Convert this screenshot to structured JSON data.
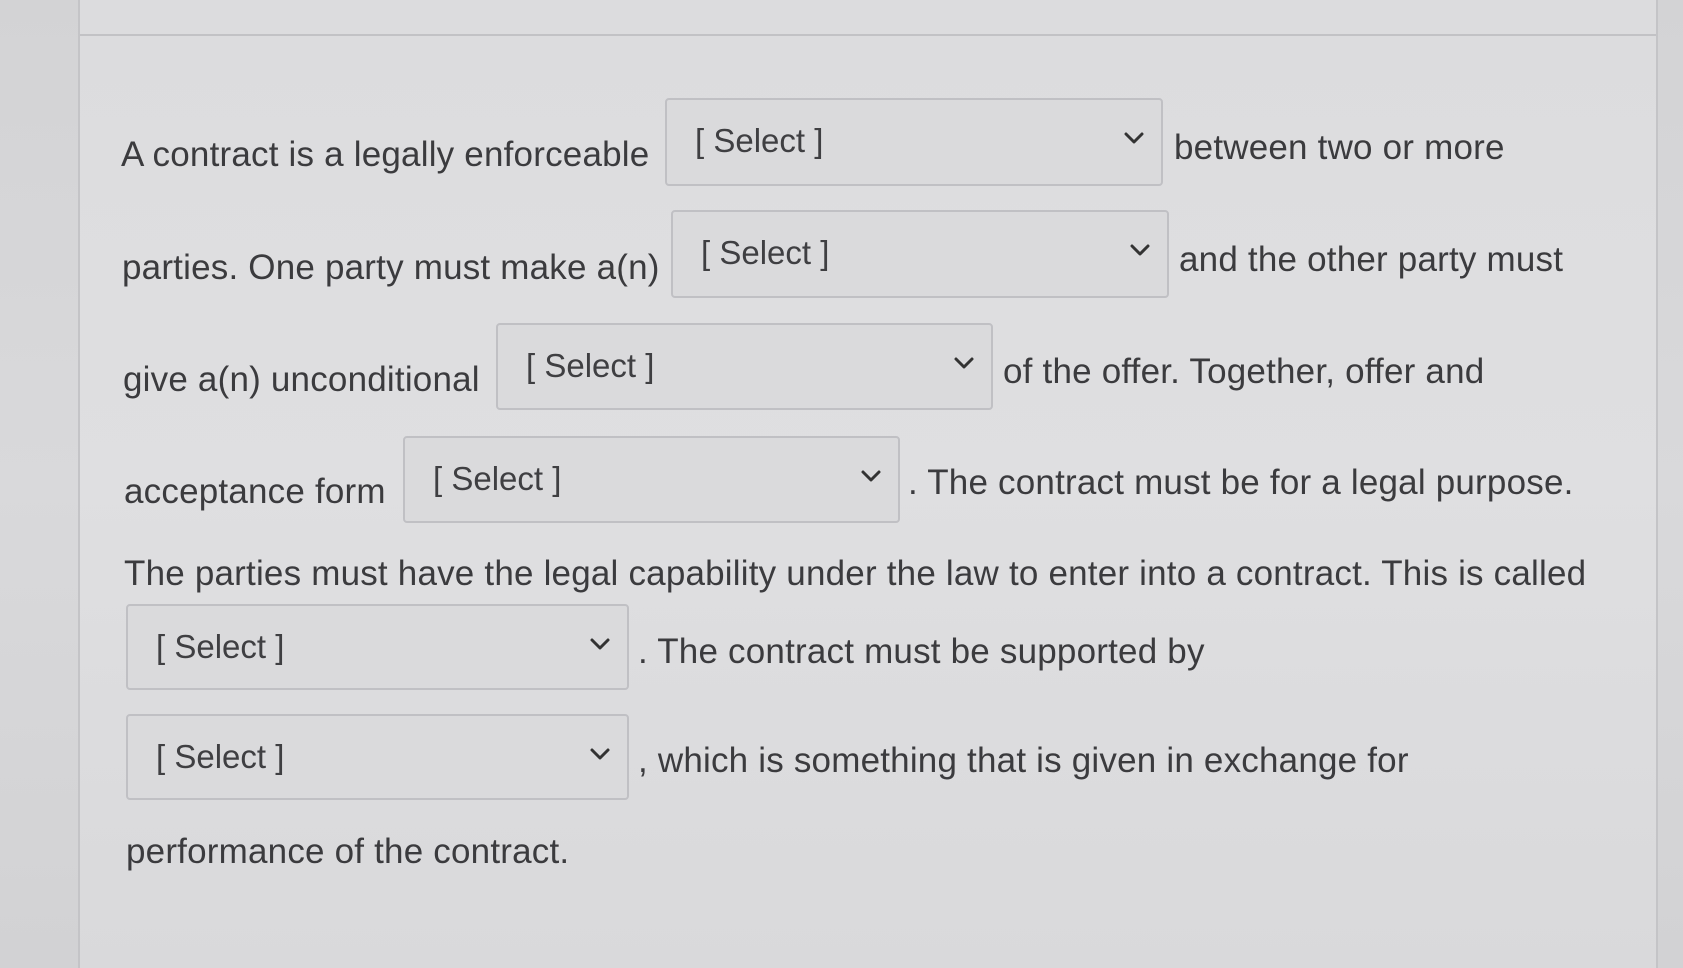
{
  "question": {
    "line1_start": "A contract is a legally enforceable",
    "line1_end": "between two or more",
    "line2_start": "parties. One party must make a(n)",
    "line2_end": "and the other party must",
    "line3_start": "give a(n) unconditional",
    "line3_end": "of the offer. Together, offer and",
    "line4_start": "acceptance form",
    "line4_end": ". The contract must be for a legal purpose.",
    "line5": "The parties must have the legal capability under the law to enter into a contract. This is called",
    "line6_end": ". The contract must be supported by",
    "line7_end": ", which is something that is given in exchange for",
    "line8": "performance of the contract."
  },
  "dropdowns": [
    {
      "selected": "[ Select ]",
      "icon": "chevron-down-icon"
    },
    {
      "selected": "[ Select ]",
      "icon": "chevron-down-icon"
    },
    {
      "selected": "[ Select ]",
      "icon": "chevron-down-icon"
    },
    {
      "selected": "[ Select ]",
      "icon": "chevron-down-icon"
    },
    {
      "selected": "[ Select ]",
      "icon": "chevron-down-icon"
    },
    {
      "selected": "[ Select ]",
      "icon": "chevron-down-icon"
    }
  ]
}
